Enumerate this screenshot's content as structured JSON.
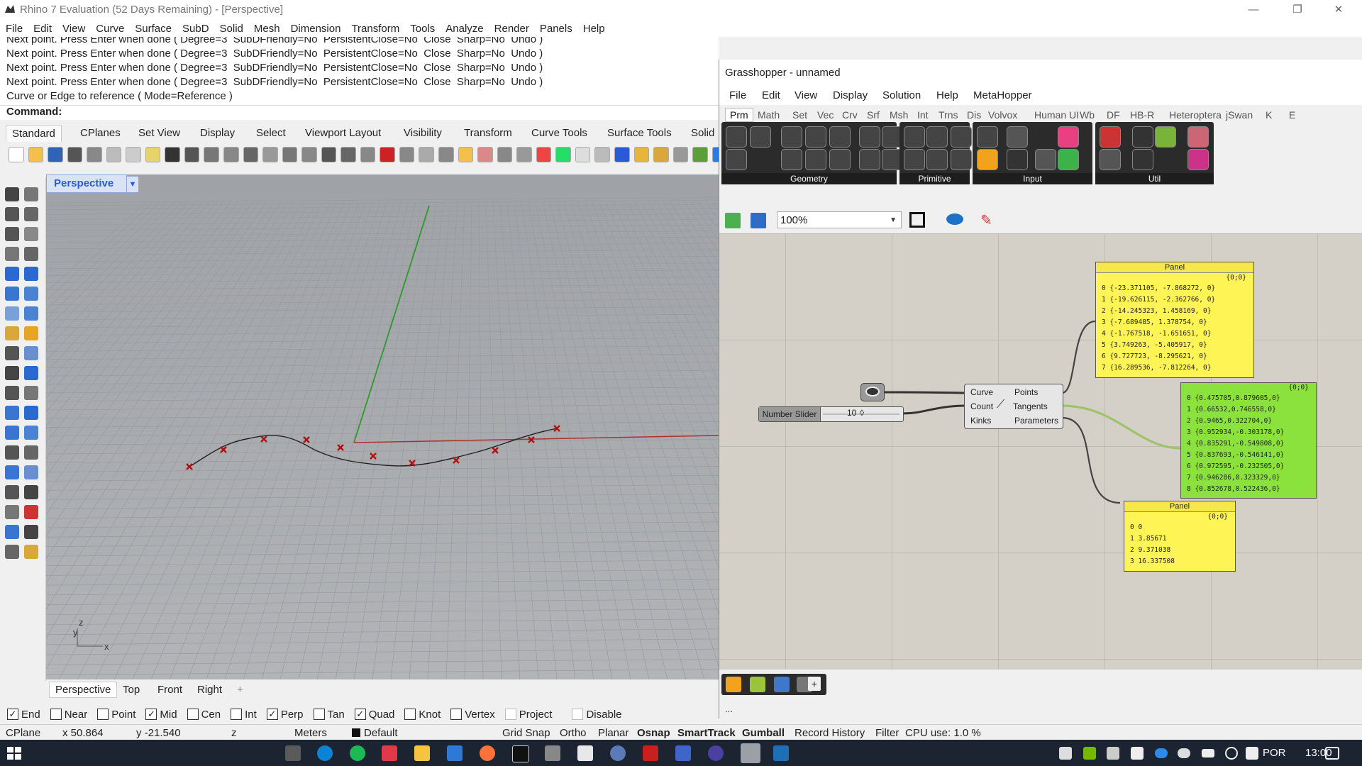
{
  "rhino": {
    "title": "Rhino 7 Evaluation (52 Days Remaining) - [Perspective]",
    "menu": [
      "File",
      "Edit",
      "View",
      "Curve",
      "Surface",
      "SubD",
      "Solid",
      "Mesh",
      "Dimension",
      "Transform",
      "Tools",
      "Analyze",
      "Render",
      "Panels",
      "Help"
    ],
    "history": [
      "Next point. Press Enter when done ( Degree=3  SubDFriendly=No  PersistentClose=No  Close  Sharp=No  Undo )",
      "Next point. Press Enter when done ( Degree=3  SubDFriendly=No  PersistentClose=No  Close  Sharp=No  Undo )",
      "Next point. Press Enter when done ( Degree=3  SubDFriendly=No  PersistentClose=No  Close  Sharp=No  Undo )",
      "Next point. Press Enter when done ( Degree=3  SubDFriendly=No  PersistentClose=No  Close  Sharp=No  Undo )",
      "Curve or Edge to reference ( Mode=Reference )"
    ],
    "command_label": "Command:",
    "toolbar_tabs": [
      "Standard",
      "CPlanes",
      "Set View",
      "Display",
      "Select",
      "Viewport Layout",
      "Visibility",
      "Transform",
      "Curve Tools",
      "Surface Tools",
      "Solid"
    ],
    "viewport_title": "Perspective",
    "view_tabs": [
      "Perspective",
      "Top",
      "Front",
      "Right"
    ],
    "add_tab": "+",
    "osnaps": [
      {
        "label": "End",
        "checked": true
      },
      {
        "label": "Near",
        "checked": false
      },
      {
        "label": "Point",
        "checked": false
      },
      {
        "label": "Mid",
        "checked": true
      },
      {
        "label": "Cen",
        "checked": false
      },
      {
        "label": "Int",
        "checked": false
      },
      {
        "label": "Perp",
        "checked": true
      },
      {
        "label": "Tan",
        "checked": false
      },
      {
        "label": "Quad",
        "checked": true
      },
      {
        "label": "Knot",
        "checked": false
      },
      {
        "label": "Vertex",
        "checked": false
      },
      {
        "label": "Project",
        "checked": false
      },
      {
        "label": "Disable",
        "checked": false
      }
    ],
    "status": {
      "cplane": "CPlane",
      "x": "x 50.864",
      "y": "y -21.540",
      "z": "z",
      "units": "Meters",
      "layer": "Default",
      "grid_snap": "Grid Snap",
      "ortho": "Ortho",
      "planar": "Planar",
      "osnap": "Osnap",
      "smarttrack": "SmartTrack",
      "gumball": "Gumball",
      "record_history": "Record History",
      "filter": "Filter",
      "cpu": "CPU use: 1.0 %"
    },
    "axis_labels": {
      "x": "x",
      "y": "y",
      "z": "z"
    }
  },
  "grasshopper": {
    "title": "Grasshopper - unnamed",
    "menu": [
      "File",
      "Edit",
      "View",
      "Display",
      "Solution",
      "Help",
      "MetaHopper"
    ],
    "tabs": [
      "Prm",
      "Math",
      "Set",
      "Vec",
      "Crv",
      "Srf",
      "Msh",
      "Int",
      "Trns",
      "Dis",
      "Volvox",
      "Human UI",
      "Wb",
      "DF",
      "HB-R",
      "Heteroptera",
      "jSwan",
      "K",
      "E"
    ],
    "ribbon_groups": [
      "Geometry",
      "Primitive",
      "Input",
      "Util"
    ],
    "zoom": "100%",
    "slider": {
      "label": "Number Slider",
      "value": "10"
    },
    "divide": {
      "inputs": [
        "Curve",
        "Count",
        "Kinks"
      ],
      "outputs": [
        "Points",
        "Tangents",
        "Parameters"
      ]
    },
    "panel_points": {
      "title": "Panel",
      "path": "{0;0}",
      "rows": [
        "0 {-23.371105, -7.868272, 0}",
        "1 {-19.626115, -2.362766, 0}",
        "2 {-14.245323, 1.458169, 0}",
        "3 {-7.689485, 1.378754, 0}",
        "4 {-1.767518, -1.651651, 0}",
        "5 {3.749263, -5.405917, 0}",
        "6 {9.727723, -8.295621, 0}",
        "7 {16.289536, -7.812264, 0}"
      ]
    },
    "panel_tangents": {
      "path": "{0;0}",
      "rows": [
        "0 {0.475705,0.879605,0}",
        "1 {0.66532,0.746558,0}",
        "2 {0.9465,0.322704,0}",
        "3 {0.952934,-0.303178,0}",
        "4 {0.835291,-0.549808,0}",
        "5 {0.837693,-0.546141,0}",
        "6 {0.972595,-0.232505,0}",
        "7 {0.946286,0.323329,0}",
        "8 {0.852678,0.522436,0}"
      ]
    },
    "panel_params": {
      "title": "Panel",
      "path": "{0;0}",
      "rows": [
        "0 0",
        "1 3.85671",
        "2 9.371038",
        "3 16.337508"
      ]
    },
    "status_dots": "..."
  },
  "taskbar": {
    "lang": "POR",
    "time": "13:00"
  },
  "colors": {
    "accent": "#2a5bd7",
    "panel_yellow": "#fff455",
    "panel_green": "#8ce23c",
    "curve_points": "#b01010"
  }
}
